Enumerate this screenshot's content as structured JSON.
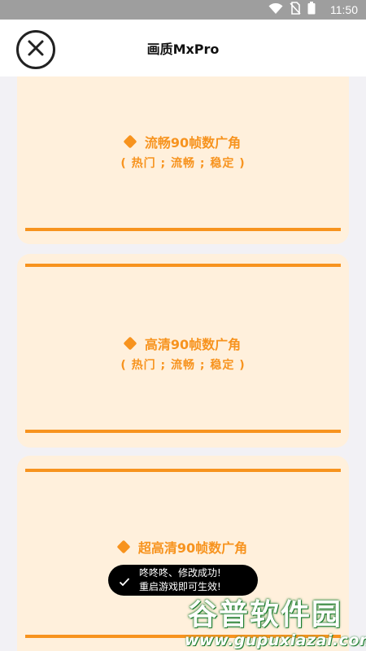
{
  "status_bar": {
    "time": "11:50",
    "icons": [
      "wifi-icon",
      "no-sim-icon",
      "battery-icon"
    ]
  },
  "header": {
    "title": "画质MxPro",
    "close_icon": "close-icon"
  },
  "cards": [
    {
      "title": "流畅90帧数广角",
      "subtitle": "( 热门 ; 流畅 ; 稳定 )"
    },
    {
      "title": "高清90帧数广角",
      "subtitle": "( 热门 ; 流畅 ; 稳定 )"
    },
    {
      "title": "超高清90帧数广角"
    }
  ],
  "toast": {
    "line1": "咚咚咚、修改成功!",
    "line2": "重启游戏即可生效!"
  },
  "watermark": {
    "text": "谷普软件园",
    "url": "www.gupuxiazai.com"
  },
  "colors": {
    "accent": "#f7931e",
    "card_bg": "#fff0dc",
    "page_bg": "#f2f1f5",
    "status_bar": "#9e9e9e"
  }
}
